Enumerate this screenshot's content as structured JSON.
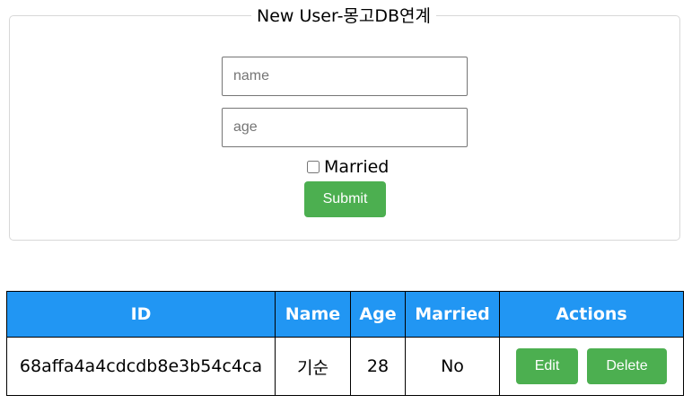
{
  "form": {
    "legend": "New User-몽고DB연계",
    "name_placeholder": "name",
    "age_placeholder": "age",
    "married_label": "Married",
    "married_checked": false,
    "submit_label": "Submit"
  },
  "table": {
    "headers": {
      "id": "ID",
      "name": "Name",
      "age": "Age",
      "married": "Married",
      "actions": "Actions"
    },
    "rows": [
      {
        "id": "68affa4a4cdcdb8e3b54c4ca",
        "name": "기순",
        "age": "28",
        "married": "No",
        "edit_label": "Edit",
        "delete_label": "Delete"
      }
    ]
  },
  "colors": {
    "header_bg": "#2196f3",
    "button_green": "#4caf50"
  }
}
